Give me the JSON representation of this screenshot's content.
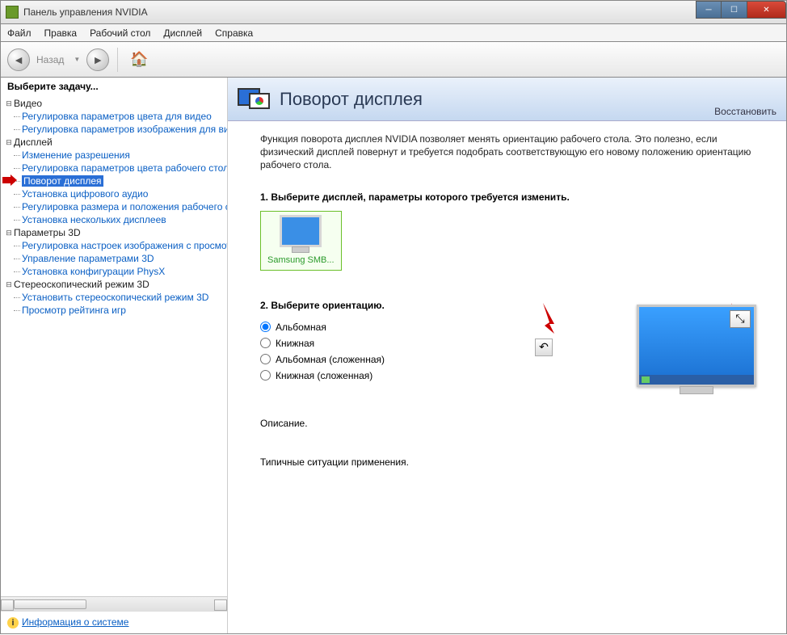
{
  "window": {
    "title": "Панель управления NVIDIA"
  },
  "menu": {
    "file": "Файл",
    "edit": "Правка",
    "desktop": "Рабочий стол",
    "display": "Дисплей",
    "help": "Справка"
  },
  "toolbar": {
    "back": "Назад"
  },
  "sidebar": {
    "task_label": "Выберите задачу...",
    "groups": [
      {
        "label": "Видео",
        "items": [
          "Регулировка параметров цвета для видео",
          "Регулировка параметров изображения для видео"
        ]
      },
      {
        "label": "Дисплей",
        "items": [
          "Изменение разрешения",
          "Регулировка параметров цвета рабочего стола",
          "Поворот дисплея",
          "Установка цифрового аудио",
          "Регулировка размера и положения рабочего стола",
          "Установка нескольких дисплеев"
        ]
      },
      {
        "label": "Параметры 3D",
        "items": [
          "Регулировка настроек изображения с просмотром",
          "Управление параметрами 3D",
          "Установка конфигурации PhysX"
        ]
      },
      {
        "label": "Стереоскопический режим 3D",
        "items": [
          "Установить стереоскопический режим 3D",
          "Просмотр рейтинга игр"
        ]
      }
    ],
    "sysinfo": "Информация о системе"
  },
  "page": {
    "title": "Поворот дисплея",
    "restore": "Восстановить",
    "intro": "Функция поворота дисплея NVIDIA позволяет менять ориентацию рабочего стола. Это полезно, если физический дисплей повернут и требуется подобрать соответствующую его новому положению ориентацию рабочего стола.",
    "step1_title": "1. Выберите дисплей, параметры которого требуется изменить.",
    "display_name": "Samsung SMB...",
    "step2_title": "2. Выберите ориентацию.",
    "orientations": [
      "Альбомная",
      "Книжная",
      "Альбомная (сложенная)",
      "Книжная (сложенная)"
    ],
    "selected_orientation": 0,
    "desc_label": "Описание.",
    "typical_label": "Типичные ситуации применения."
  }
}
